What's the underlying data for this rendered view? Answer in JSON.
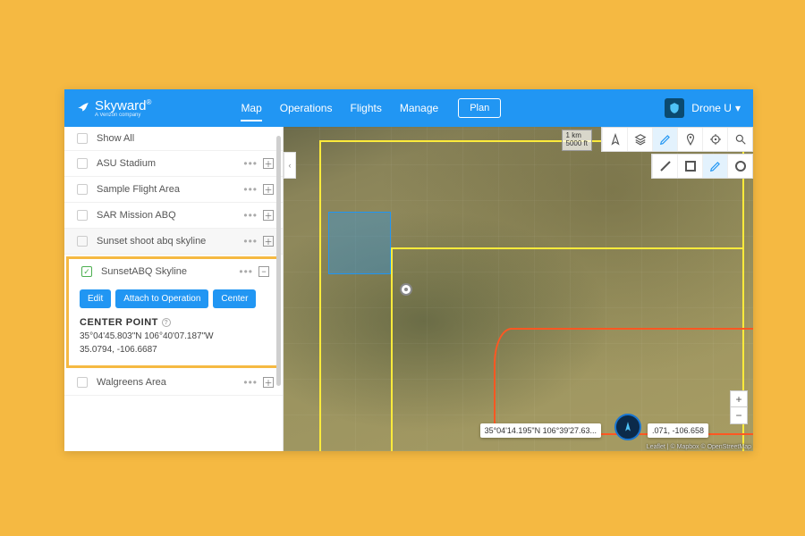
{
  "header": {
    "brand": "Skyward",
    "tagline": "A Verizon company",
    "nav": {
      "map": "Map",
      "operations": "Operations",
      "flights": "Flights",
      "manage": "Manage"
    },
    "plan": "Plan",
    "user": "Drone U"
  },
  "sidebar": {
    "items": [
      {
        "label": "Show All"
      },
      {
        "label": "ASU Stadium"
      },
      {
        "label": "Sample Flight Area"
      },
      {
        "label": "SAR Mission ABQ"
      },
      {
        "label": "Sunset shoot abq skyline"
      },
      {
        "label": "SunsetABQ Skyline"
      },
      {
        "label": "Walgreens Area"
      }
    ],
    "selected": {
      "buttons": {
        "edit": "Edit",
        "attach": "Attach to Operation",
        "center": "Center"
      },
      "cp_title": "CENTER POINT",
      "cp_dms": "35°04'45.803\"N 106°40'07.187\"W",
      "cp_dec": "35.0794, -106.6687"
    }
  },
  "map": {
    "scale_km": "1 km",
    "scale_ft": "5000 ft",
    "cursor_dms": "35°04'14.195\"N 106°39'27.63...",
    "cursor_dec": ".071, -106.658",
    "attribution": "Leaflet | © Mapbox © OpenStreetMap"
  }
}
